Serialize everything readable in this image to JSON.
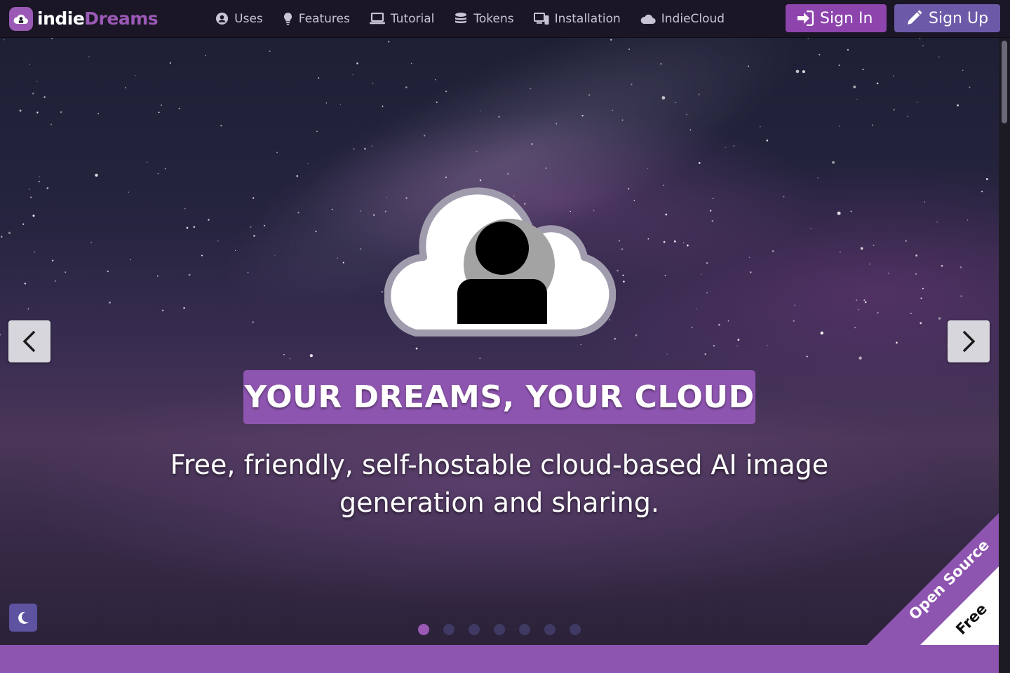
{
  "brand": {
    "indie": "indie",
    "dreams": "Dreams"
  },
  "nav": {
    "items": [
      {
        "label": "Uses",
        "icon": "user-circle-icon"
      },
      {
        "label": "Features",
        "icon": "lightbulb-icon"
      },
      {
        "label": "Tutorial",
        "icon": "laptop-icon"
      },
      {
        "label": "Tokens",
        "icon": "coins-icon"
      },
      {
        "label": "Installation",
        "icon": "devices-icon"
      },
      {
        "label": "IndieCloud",
        "icon": "cloud-icon"
      }
    ],
    "signin_label": "Sign In",
    "signup_label": "Sign Up"
  },
  "hero": {
    "tagline": "YOUR DREAMS, YOUR CLOUD",
    "subtitle": "Free, friendly, self-hostable cloud-based AI image generation and sharing.",
    "slide_count": 7,
    "active_slide": 1
  },
  "ribbon": {
    "primary": "Open Source",
    "secondary": "Free"
  },
  "colors": {
    "accent": "#9b59b6",
    "signup": "#6c5aa9",
    "navbar": "#1a1625"
  }
}
